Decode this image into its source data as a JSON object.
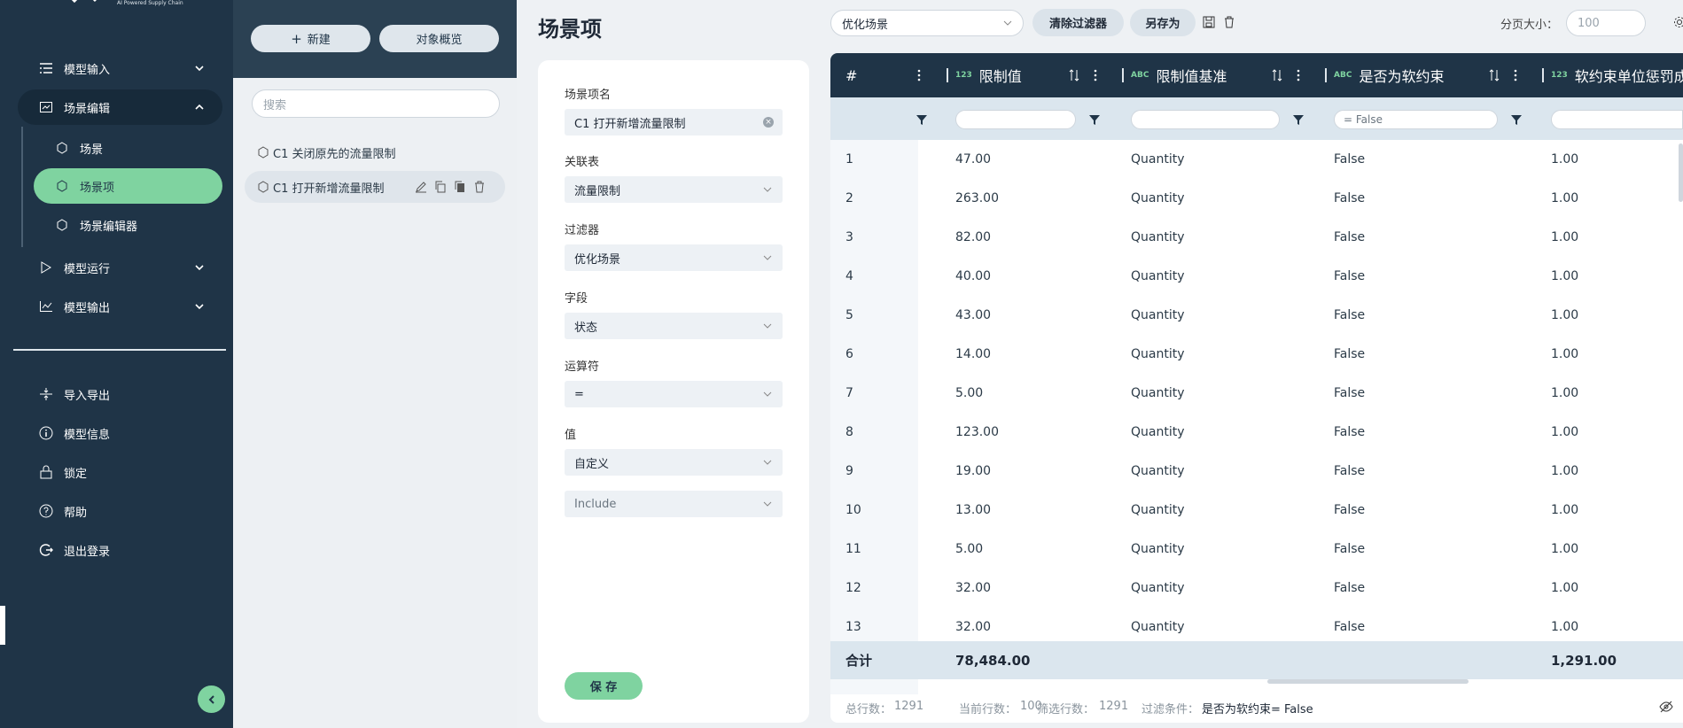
{
  "brand": {
    "tagline": "AI Powered Supply Chain"
  },
  "sidebar": {
    "items": [
      {
        "label": "模型输入",
        "icon": "list-icon"
      },
      {
        "label": "场景编辑",
        "icon": "chart-icon"
      },
      {
        "label": "模型运行",
        "icon": "play-icon"
      },
      {
        "label": "模型输出",
        "icon": "line-chart-icon"
      }
    ],
    "subitems": [
      {
        "label": "场景",
        "icon": "hexagon-icon"
      },
      {
        "label": "场景项",
        "icon": "hexagon-icon"
      },
      {
        "label": "场景编辑器",
        "icon": "hexagon-icon"
      }
    ],
    "bottom": [
      {
        "label": "导入导出",
        "icon": "import-export-icon"
      },
      {
        "label": "模型信息",
        "icon": "info-icon"
      },
      {
        "label": "锁定",
        "icon": "lock-icon"
      },
      {
        "label": "帮助",
        "icon": "help-icon"
      },
      {
        "label": "退出登录",
        "icon": "logout-icon"
      }
    ]
  },
  "objects": {
    "new_label": "新建",
    "overview_label": "对象概览",
    "search_placeholder": "搜索",
    "items": [
      "C1 关闭原先的流量限制",
      "C1 打开新增流量限制"
    ]
  },
  "header": {
    "title": "场景项",
    "scene_select": "优化场景",
    "clear_filter": "清除过滤器",
    "save_as": "另存为",
    "page_size_label": "分页大小：",
    "page_size_value": "100"
  },
  "form": {
    "name_label": "场景项名",
    "name_value": "C1 打开新增流量限制",
    "table_label": "关联表",
    "table_value": "流量限制",
    "filter_label": "过滤器",
    "filter_value": "优化场景",
    "field_label": "字段",
    "field_value": "状态",
    "operator_label": "运算符",
    "operator_value": "=",
    "value_label": "值",
    "value_value": "自定义",
    "include_value": "Include",
    "save_label": "保 存"
  },
  "grid": {
    "columns": [
      {
        "label": "#",
        "type": ""
      },
      {
        "label": "限制值",
        "type": "123"
      },
      {
        "label": "限制值基准",
        "type": "ABC"
      },
      {
        "label": "是否为软约束",
        "type": "ABC"
      },
      {
        "label": "软约束单位惩罚成",
        "type": "123"
      }
    ],
    "filter_soft_value": "= False",
    "rows": [
      [
        "1",
        "47.00",
        "Quantity",
        "False",
        "1.00"
      ],
      [
        "2",
        "263.00",
        "Quantity",
        "False",
        "1.00"
      ],
      [
        "3",
        "82.00",
        "Quantity",
        "False",
        "1.00"
      ],
      [
        "4",
        "40.00",
        "Quantity",
        "False",
        "1.00"
      ],
      [
        "5",
        "43.00",
        "Quantity",
        "False",
        "1.00"
      ],
      [
        "6",
        "14.00",
        "Quantity",
        "False",
        "1.00"
      ],
      [
        "7",
        "5.00",
        "Quantity",
        "False",
        "1.00"
      ],
      [
        "8",
        "123.00",
        "Quantity",
        "False",
        "1.00"
      ],
      [
        "9",
        "19.00",
        "Quantity",
        "False",
        "1.00"
      ],
      [
        "10",
        "13.00",
        "Quantity",
        "False",
        "1.00"
      ],
      [
        "11",
        "5.00",
        "Quantity",
        "False",
        "1.00"
      ],
      [
        "12",
        "32.00",
        "Quantity",
        "False",
        "1.00"
      ],
      [
        "13",
        "32.00",
        "Quantity",
        "False",
        "1.00"
      ]
    ],
    "footer": {
      "label": "合计",
      "limit_total": "78,484.00",
      "penalty_total": "1,291.00"
    },
    "status": {
      "total_label": "总行数：",
      "total_value": "1291",
      "current_label": "当前行数：",
      "current_value": "100",
      "filtered_label": "筛选行数：",
      "filtered_value": "1291",
      "condition_label": "过滤条件：",
      "condition_value": "是否为软约束= False"
    }
  },
  "colors": {
    "sidebar": "#1f3447",
    "accent": "#7fd3a0",
    "header": "#1f3447"
  }
}
